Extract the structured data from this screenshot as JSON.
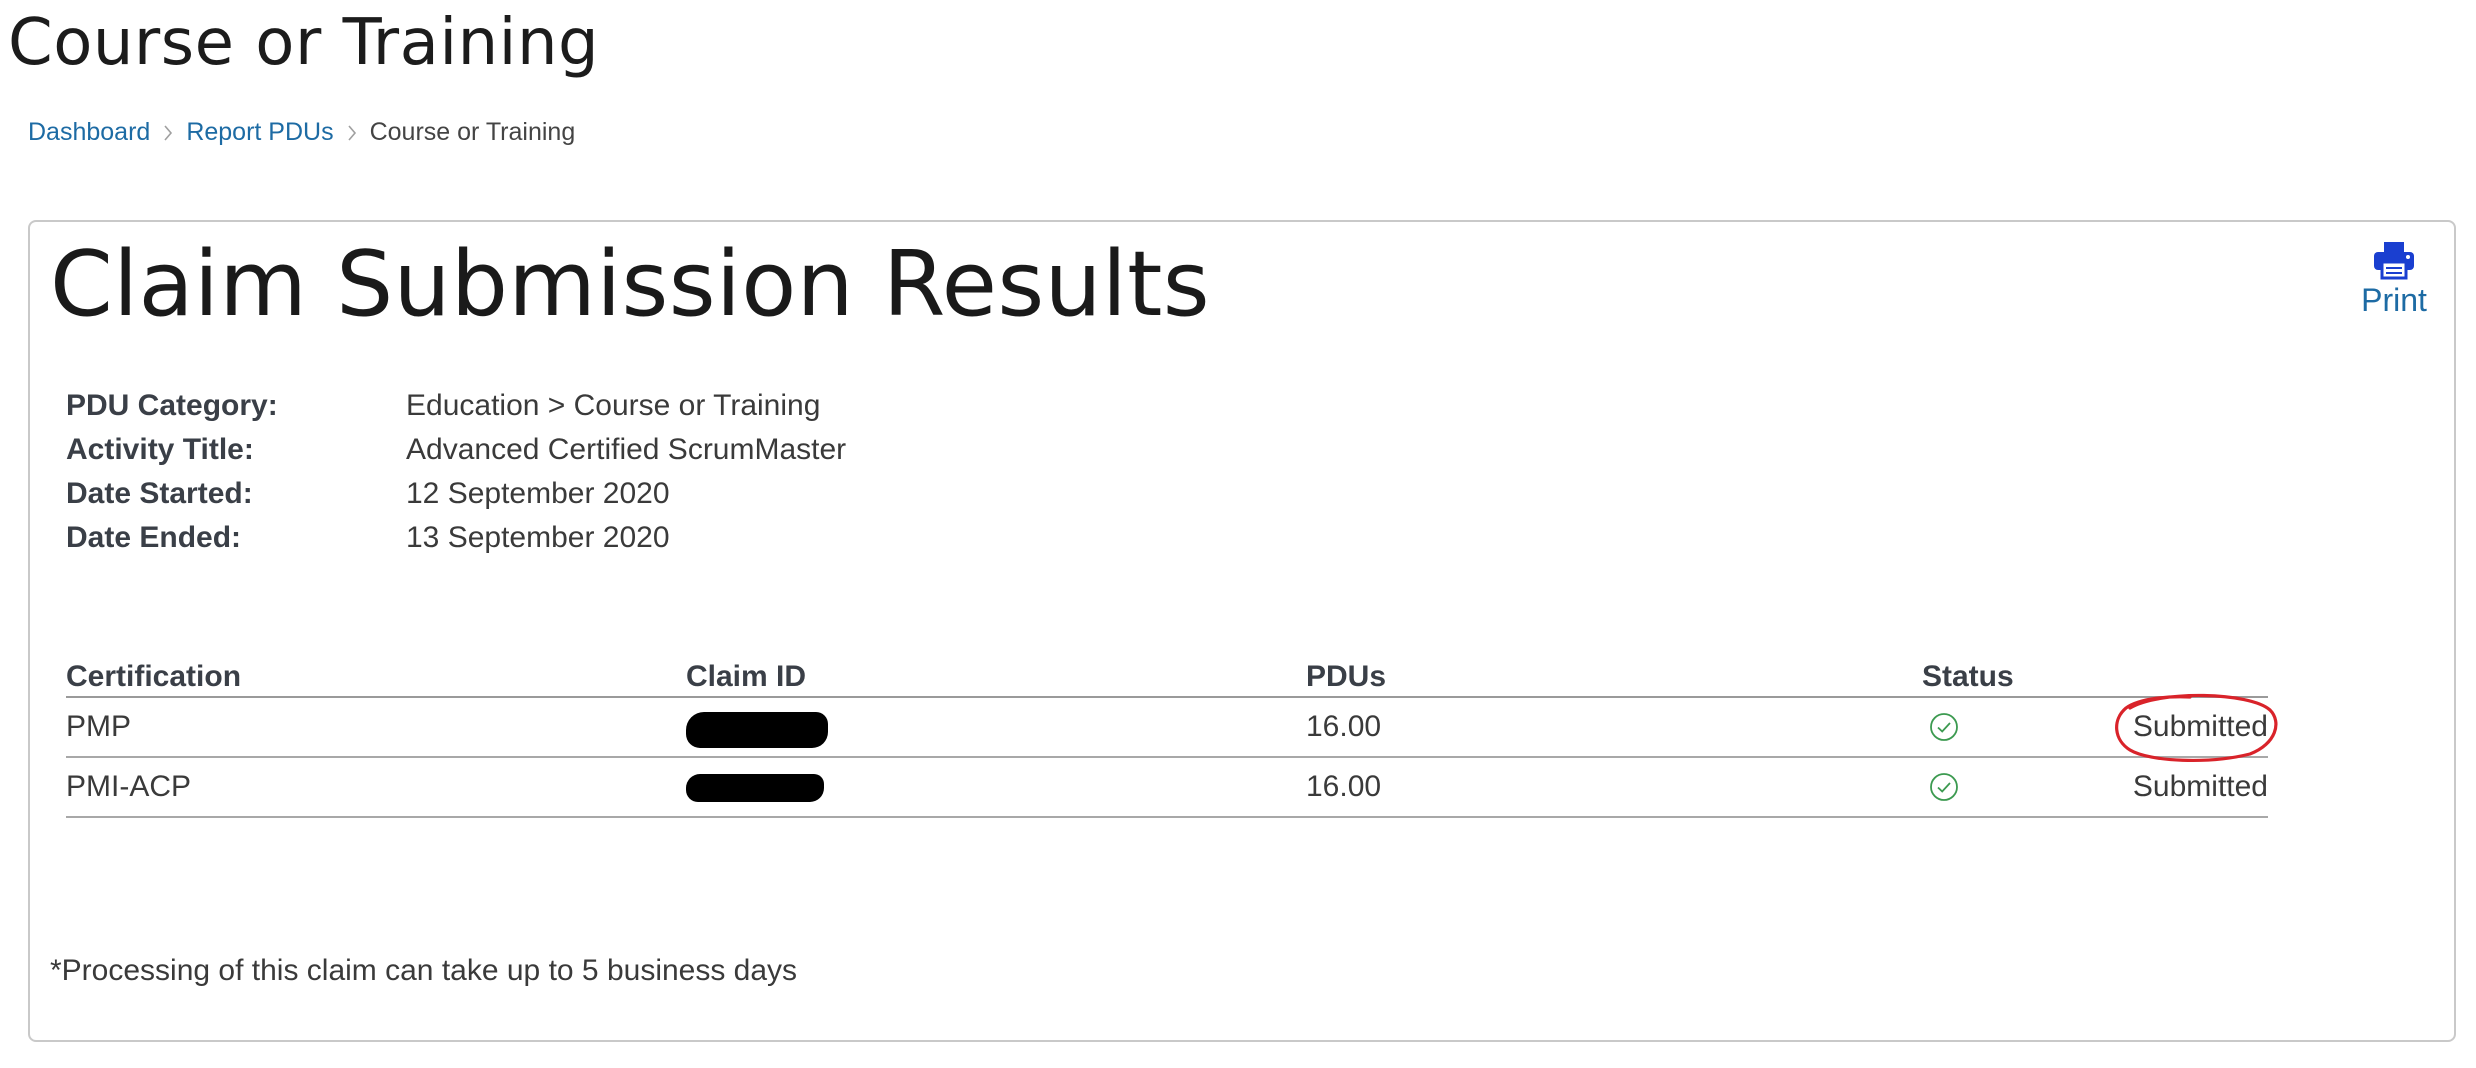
{
  "page": {
    "title": "Course or Training"
  },
  "breadcrumb": {
    "items": [
      {
        "label": "Dashboard"
      },
      {
        "label": "Report PDUs"
      },
      {
        "label": "Course or Training"
      }
    ]
  },
  "card": {
    "title": "Claim Submission Results",
    "print_label": "Print",
    "print_icon": "printer-icon",
    "details": [
      {
        "label": "PDU Category:",
        "value": "Education > Course or Training"
      },
      {
        "label": "Activity Title:",
        "value": "Advanced Certified ScrumMaster"
      },
      {
        "label": "Date Started:",
        "value": "12 September 2020"
      },
      {
        "label": "Date Ended:",
        "value": "13 September 2020"
      }
    ],
    "table": {
      "headers": [
        "Certification",
        "Claim ID",
        "PDUs",
        "Status"
      ],
      "rows": [
        {
          "certification": "PMP",
          "claim_id": "",
          "pdus": "16.00",
          "status_icon": "check-circle-icon",
          "status": "Submitted"
        },
        {
          "certification": "PMI-ACP",
          "claim_id": "",
          "pdus": "16.00",
          "status_icon": "check-circle-icon",
          "status": "Submitted"
        }
      ]
    },
    "footnote": "*Processing of this claim can take up to 5 business days"
  },
  "colors": {
    "link": "#1d6ba4",
    "print_icon": "#1a3fd0",
    "status_ok": "#3c9a50",
    "annotation": "#d9232a",
    "redaction": "#000000"
  }
}
